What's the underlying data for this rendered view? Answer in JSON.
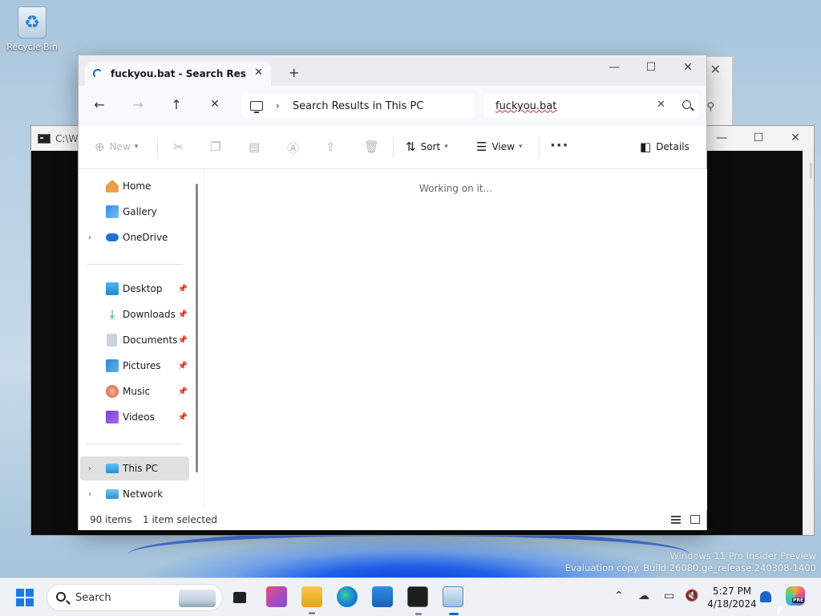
{
  "desktop": {
    "recycle_bin_label": "Recycle Bin"
  },
  "background_windows": {
    "cmd_title": "C:\\WI"
  },
  "explorer": {
    "tab_title": "fuckyou.bat - Search Results in",
    "address": {
      "location": "Search Results in This PC"
    },
    "search": {
      "value": "fuckyou.bat"
    },
    "commands": {
      "new": "New",
      "sort": "Sort",
      "view": "View",
      "details": "Details"
    },
    "nav_pane": {
      "items": [
        {
          "label": "Home"
        },
        {
          "label": "Gallery"
        },
        {
          "label": "OneDrive"
        },
        {
          "label": "Desktop"
        },
        {
          "label": "Downloads"
        },
        {
          "label": "Documents"
        },
        {
          "label": "Pictures"
        },
        {
          "label": "Music"
        },
        {
          "label": "Videos"
        },
        {
          "label": "This PC"
        },
        {
          "label": "Network"
        }
      ]
    },
    "content": {
      "status_message": "Working on it..."
    },
    "statusbar": {
      "item_count": "90 items",
      "selection": "1 item selected"
    }
  },
  "watermark": {
    "line1": "Windows 11 Pro Insider Preview",
    "line2": "Evaluation copy. Build 26080.ge_release.240308-1400"
  },
  "taskbar": {
    "search_label": "Search",
    "time": "5:27 PM",
    "date": "4/18/2024"
  },
  "colors": {
    "accent": "#1a66c7",
    "folder_yellow": "#f2b82f",
    "cmd_background": "#0c0c0c"
  }
}
